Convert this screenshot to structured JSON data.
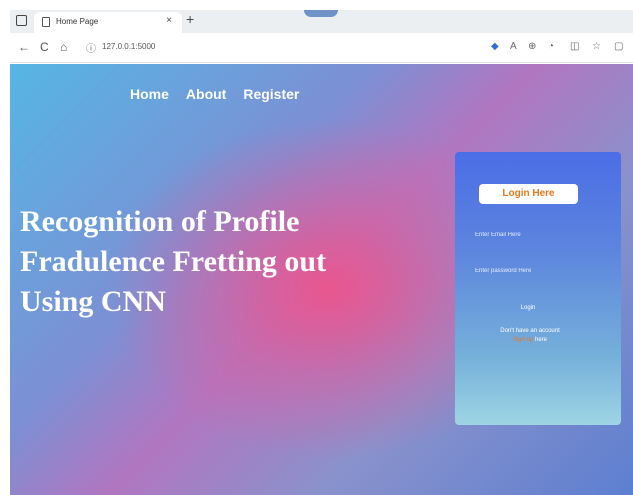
{
  "browser": {
    "tab_title": "Home Page",
    "tab_close": "×",
    "new_tab": "+",
    "url": "127.0.0.1:5000",
    "nav": {
      "back": "←",
      "refresh": "C",
      "home": "⌂"
    }
  },
  "nav": {
    "items": [
      "Home",
      "About",
      "Register"
    ]
  },
  "hero": {
    "title_lines": [
      "Recognition of Profile",
      "Fradulence Fretting out",
      "Using CNN"
    ]
  },
  "login": {
    "header": "Login Here",
    "email_placeholder": "Enter Email Here",
    "password_placeholder": "Enter password Here",
    "button": "Login",
    "signup_prefix": "Don't have an account",
    "signup_link": "Sign up",
    "signup_suffix": "here"
  },
  "colors": {
    "accent": "#e8791f",
    "card_top": "#4b6ee6",
    "card_bottom": "#9ed5e4",
    "background_center": "#ec548c"
  }
}
